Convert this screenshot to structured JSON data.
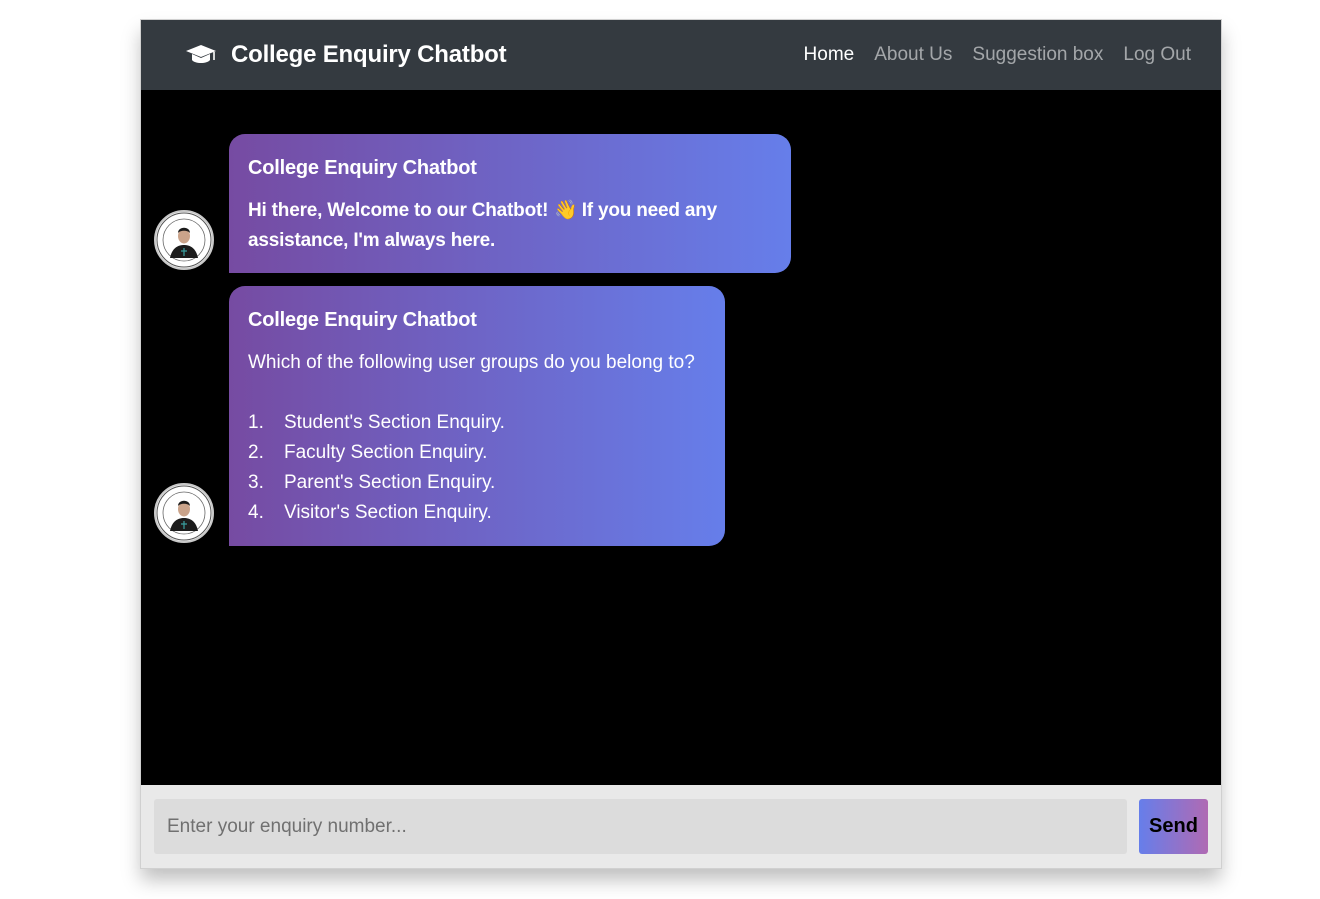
{
  "navbar": {
    "brand_icon": "graduation-cap-icon",
    "brand_title": "College Enquiry Chatbot",
    "links": [
      {
        "label": "Home",
        "active": true
      },
      {
        "label": "About Us",
        "active": false
      },
      {
        "label": "Suggestion box",
        "active": false
      },
      {
        "label": "Log Out",
        "active": false
      }
    ]
  },
  "messages": [
    {
      "sender": "College Enquiry Chatbot",
      "text_before": "Hi there, Welcome to our Chatbot!",
      "emoji": "👋",
      "text_after": "If you need any assistance, I'm always here."
    },
    {
      "sender": "College Enquiry Chatbot",
      "text": "Which of the following user groups do you belong to?",
      "options": [
        {
          "num": "1.",
          "label": "Student's Section Enquiry."
        },
        {
          "num": "2.",
          "label": "Faculty Section Enquiry."
        },
        {
          "num": "3.",
          "label": "Parent's Section Enquiry."
        },
        {
          "num": "4.",
          "label": "Visitor's Section Enquiry."
        }
      ]
    }
  ],
  "input": {
    "placeholder": "Enter your enquiry number...",
    "value": "",
    "send_label": "Send"
  },
  "colors": {
    "navbar_bg": "#343a40",
    "bubble_gradient_start": "#764ba2",
    "bubble_gradient_end": "#667eea",
    "chat_bg": "#000000"
  }
}
